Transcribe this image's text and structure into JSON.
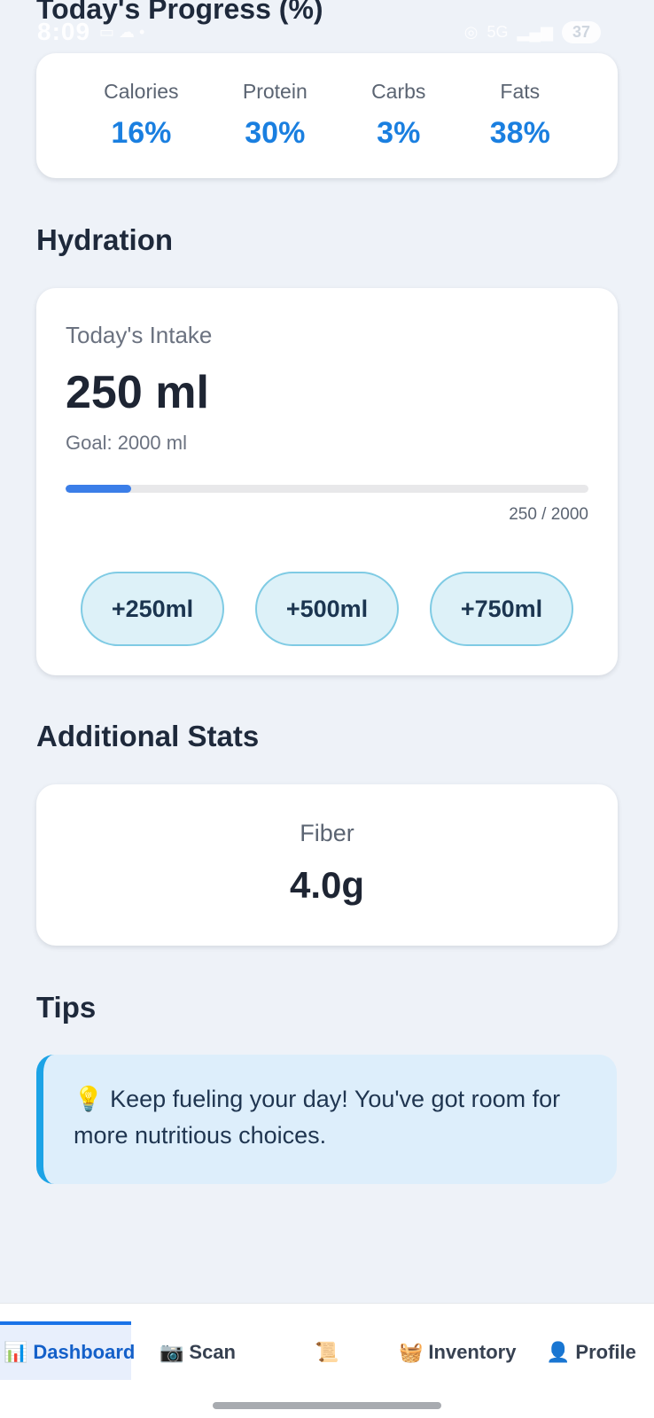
{
  "status_bar": {
    "time": "8:09",
    "battery": "37",
    "network": "5G"
  },
  "progress": {
    "heading": "Today's Progress (%)",
    "items": [
      {
        "label": "Calories",
        "value": "16%"
      },
      {
        "label": "Protein",
        "value": "30%"
      },
      {
        "label": "Carbs",
        "value": "3%"
      },
      {
        "label": "Fats",
        "value": "38%"
      }
    ]
  },
  "hydration": {
    "title": "Hydration",
    "intake_label": "Today's Intake",
    "intake_value": "250 ml",
    "goal_label": "Goal: 2000 ml",
    "progress_fraction": 0.125,
    "count_text": "250 / 2000",
    "buttons": [
      "+250ml",
      "+500ml",
      "+750ml"
    ]
  },
  "additional_stats": {
    "title": "Additional Stats",
    "fiber_label": "Fiber",
    "fiber_value": "4.0g"
  },
  "tips": {
    "title": "Tips",
    "icon": "lightbulb-icon",
    "text": "💡 Keep fueling your day! You've got room for more nutritious choices."
  },
  "nav": {
    "items": [
      {
        "label": "Dashboard",
        "icon": "📊",
        "active": true
      },
      {
        "label": "Scan",
        "icon": "📷",
        "active": false
      },
      {
        "label": "",
        "icon": "📜",
        "active": false
      },
      {
        "label": "Inventory",
        "icon": "🧺",
        "active": false
      },
      {
        "label": "Profile",
        "icon": "👤",
        "active": false
      }
    ]
  },
  "colors": {
    "accent": "#1a7fe0",
    "progress_fill": "#3b7ee8",
    "tip_border": "#1ca3e6"
  }
}
